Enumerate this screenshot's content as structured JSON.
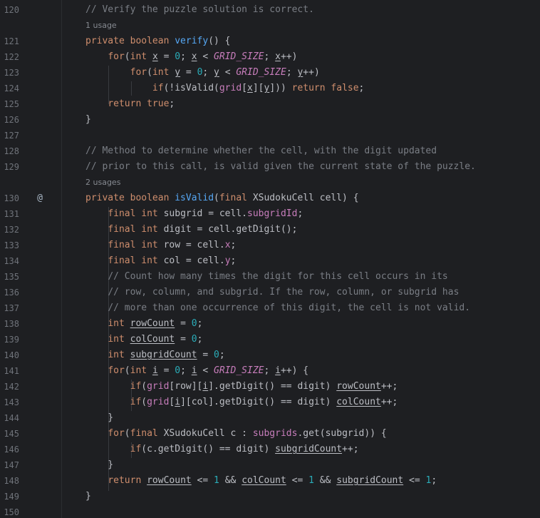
{
  "editor": {
    "lines": [
      {
        "num": "120",
        "tokens": [
          [
            "cm",
            "// Verify the puzzle solution is correct."
          ]
        ]
      },
      {
        "hint": "1 usage"
      },
      {
        "num": "121",
        "tokens": [
          [
            "kw",
            "private boolean "
          ],
          [
            "fn",
            "verify"
          ],
          [
            "def",
            "() {"
          ]
        ]
      },
      {
        "num": "122",
        "tokens": [
          [
            "def",
            "    "
          ],
          [
            "kw",
            "for"
          ],
          [
            "def",
            "("
          ],
          [
            "kw",
            "int "
          ],
          [
            "defu",
            "x"
          ],
          [
            "def",
            " = "
          ],
          [
            "num",
            "0"
          ],
          [
            "def",
            "; "
          ],
          [
            "defu",
            "x"
          ],
          [
            "def",
            " < "
          ],
          [
            "const",
            "GRID_SIZE"
          ],
          [
            "def",
            "; "
          ],
          [
            "defu",
            "x"
          ],
          [
            "def",
            "++)"
          ]
        ]
      },
      {
        "num": "123",
        "tokens": [
          [
            "def",
            "        "
          ],
          [
            "kw",
            "for"
          ],
          [
            "def",
            "("
          ],
          [
            "kw",
            "int "
          ],
          [
            "defu",
            "y"
          ],
          [
            "def",
            " = "
          ],
          [
            "num",
            "0"
          ],
          [
            "def",
            "; "
          ],
          [
            "defu",
            "y"
          ],
          [
            "def",
            " < "
          ],
          [
            "const",
            "GRID_SIZE"
          ],
          [
            "def",
            "; "
          ],
          [
            "defu",
            "y"
          ],
          [
            "def",
            "++)"
          ]
        ]
      },
      {
        "num": "124",
        "tokens": [
          [
            "def",
            "            "
          ],
          [
            "kw",
            "if"
          ],
          [
            "def",
            "(!isValid("
          ],
          [
            "fld",
            "grid"
          ],
          [
            "def",
            "["
          ],
          [
            "defu",
            "x"
          ],
          [
            "def",
            "]["
          ],
          [
            "defu",
            "y"
          ],
          [
            "def",
            "])) "
          ],
          [
            "kw",
            "return false"
          ],
          [
            "def",
            ";"
          ]
        ]
      },
      {
        "num": "125",
        "tokens": [
          [
            "def",
            "    "
          ],
          [
            "kw",
            "return true"
          ],
          [
            "def",
            ";"
          ]
        ]
      },
      {
        "num": "126",
        "tokens": [
          [
            "def",
            "}"
          ]
        ]
      },
      {
        "num": "127",
        "tokens": []
      },
      {
        "num": "128",
        "tokens": [
          [
            "cm",
            "// Method to determine whether the cell, with the digit updated"
          ]
        ]
      },
      {
        "num": "129",
        "tokens": [
          [
            "cm",
            "// prior to this call, is valid given the current state of the puzzle."
          ]
        ]
      },
      {
        "hint": "2 usages"
      },
      {
        "num": "130",
        "mark": "@",
        "tokens": [
          [
            "kw",
            "private boolean "
          ],
          [
            "fn",
            "isValid"
          ],
          [
            "def",
            "("
          ],
          [
            "kw",
            "final "
          ],
          [
            "def",
            "XSudokuCell cell) {"
          ]
        ]
      },
      {
        "num": "131",
        "tokens": [
          [
            "def",
            "    "
          ],
          [
            "kw",
            "final int "
          ],
          [
            "def",
            "subgrid = cell."
          ],
          [
            "fld",
            "subgridId"
          ],
          [
            "def",
            ";"
          ]
        ]
      },
      {
        "num": "132",
        "tokens": [
          [
            "def",
            "    "
          ],
          [
            "kw",
            "final int "
          ],
          [
            "def",
            "digit = cell.getDigit();"
          ]
        ]
      },
      {
        "num": "133",
        "tokens": [
          [
            "def",
            "    "
          ],
          [
            "kw",
            "final int "
          ],
          [
            "def",
            "row = cell."
          ],
          [
            "fld",
            "x"
          ],
          [
            "def",
            ";"
          ]
        ]
      },
      {
        "num": "134",
        "tokens": [
          [
            "def",
            "    "
          ],
          [
            "kw",
            "final int "
          ],
          [
            "def",
            "col = cell."
          ],
          [
            "fld",
            "y"
          ],
          [
            "def",
            ";"
          ]
        ]
      },
      {
        "num": "135",
        "tokens": [
          [
            "def",
            "    "
          ],
          [
            "cm",
            "// Count how many times the digit for this cell occurs in its"
          ]
        ]
      },
      {
        "num": "136",
        "tokens": [
          [
            "def",
            "    "
          ],
          [
            "cm",
            "// row, column, and subgrid. If the row, column, or subgrid has"
          ]
        ]
      },
      {
        "num": "137",
        "tokens": [
          [
            "def",
            "    "
          ],
          [
            "cm",
            "// more than one occurrence of this digit, the cell is not valid."
          ]
        ]
      },
      {
        "num": "138",
        "tokens": [
          [
            "def",
            "    "
          ],
          [
            "kw",
            "int "
          ],
          [
            "defu",
            "rowCount"
          ],
          [
            "def",
            " = "
          ],
          [
            "num",
            "0"
          ],
          [
            "def",
            ";"
          ]
        ]
      },
      {
        "num": "139",
        "tokens": [
          [
            "def",
            "    "
          ],
          [
            "kw",
            "int "
          ],
          [
            "defu",
            "colCount"
          ],
          [
            "def",
            " = "
          ],
          [
            "num",
            "0"
          ],
          [
            "def",
            ";"
          ]
        ]
      },
      {
        "num": "140",
        "tokens": [
          [
            "def",
            "    "
          ],
          [
            "kw",
            "int "
          ],
          [
            "defu",
            "subgridCount"
          ],
          [
            "def",
            " = "
          ],
          [
            "num",
            "0"
          ],
          [
            "def",
            ";"
          ]
        ]
      },
      {
        "num": "141",
        "tokens": [
          [
            "def",
            "    "
          ],
          [
            "kw",
            "for"
          ],
          [
            "def",
            "("
          ],
          [
            "kw",
            "int "
          ],
          [
            "defu",
            "i"
          ],
          [
            "def",
            " = "
          ],
          [
            "num",
            "0"
          ],
          [
            "def",
            "; "
          ],
          [
            "defu",
            "i"
          ],
          [
            "def",
            " < "
          ],
          [
            "const",
            "GRID_SIZE"
          ],
          [
            "def",
            "; "
          ],
          [
            "defu",
            "i"
          ],
          [
            "def",
            "++) {"
          ]
        ]
      },
      {
        "num": "142",
        "tokens": [
          [
            "def",
            "        "
          ],
          [
            "kw",
            "if"
          ],
          [
            "def",
            "("
          ],
          [
            "fld",
            "grid"
          ],
          [
            "def",
            "[row]["
          ],
          [
            "defu",
            "i"
          ],
          [
            "def",
            "].getDigit() == digit) "
          ],
          [
            "defu",
            "rowCount"
          ],
          [
            "def",
            "++;"
          ]
        ]
      },
      {
        "num": "143",
        "tokens": [
          [
            "def",
            "        "
          ],
          [
            "kw",
            "if"
          ],
          [
            "def",
            "("
          ],
          [
            "fld",
            "grid"
          ],
          [
            "def",
            "["
          ],
          [
            "defu",
            "i"
          ],
          [
            "def",
            "][col].getDigit() == digit) "
          ],
          [
            "defu",
            "colCount"
          ],
          [
            "def",
            "++;"
          ]
        ]
      },
      {
        "num": "144",
        "tokens": [
          [
            "def",
            "    }"
          ]
        ]
      },
      {
        "num": "145",
        "tokens": [
          [
            "def",
            "    "
          ],
          [
            "kw",
            "for"
          ],
          [
            "def",
            "("
          ],
          [
            "kw",
            "final "
          ],
          [
            "def",
            "XSudokuCell c : "
          ],
          [
            "fld",
            "subgrids"
          ],
          [
            "def",
            ".get(subgrid)) {"
          ]
        ]
      },
      {
        "num": "146",
        "tokens": [
          [
            "def",
            "        "
          ],
          [
            "kw",
            "if"
          ],
          [
            "def",
            "(c.getDigit() == digit) "
          ],
          [
            "defu",
            "subgridCount"
          ],
          [
            "def",
            "++;"
          ]
        ]
      },
      {
        "num": "147",
        "tokens": [
          [
            "def",
            "    }"
          ]
        ]
      },
      {
        "num": "148",
        "tokens": [
          [
            "def",
            "    "
          ],
          [
            "kw",
            "return "
          ],
          [
            "defu",
            "rowCount"
          ],
          [
            "def",
            " <= "
          ],
          [
            "num",
            "1"
          ],
          [
            "def",
            " && "
          ],
          [
            "defu",
            "colCount"
          ],
          [
            "def",
            " <= "
          ],
          [
            "num",
            "1"
          ],
          [
            "def",
            " && "
          ],
          [
            "defu",
            "subgridCount"
          ],
          [
            "def",
            " <= "
          ],
          [
            "num",
            "1"
          ],
          [
            "def",
            ";"
          ]
        ]
      },
      {
        "num": "149",
        "tokens": [
          [
            "def",
            "}"
          ]
        ]
      },
      {
        "num": "150",
        "tokens": []
      }
    ]
  }
}
